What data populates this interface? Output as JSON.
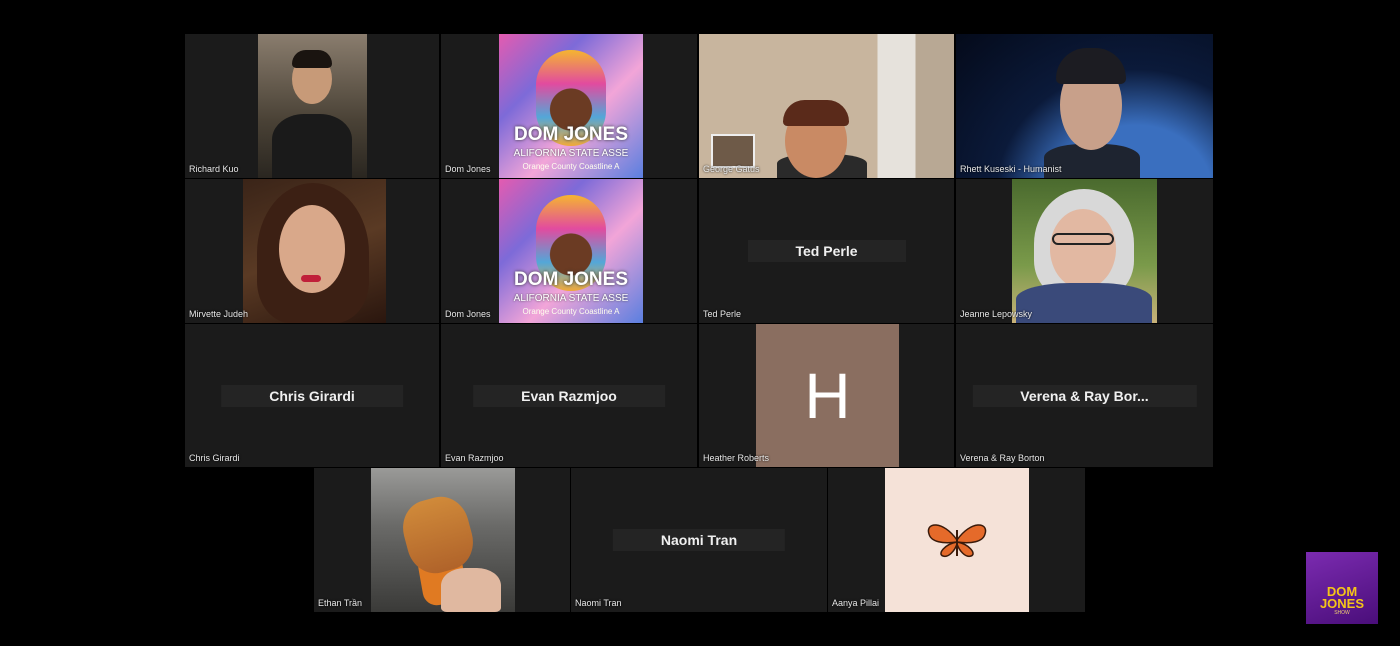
{
  "participants": [
    {
      "name": "Richard Kuo"
    },
    {
      "name": "Dom Jones",
      "poster_title": "DOM JONES",
      "poster_line1": "ALIFORNIA STATE ASSE",
      "poster_line2": "Orange County Coastline A"
    },
    {
      "name": "George Gatus"
    },
    {
      "name": "Rhett Kuseski - Humanist"
    },
    {
      "name": "Mirvette Judeh"
    },
    {
      "name": "Dom Jones",
      "poster_title": "DOM JONES",
      "poster_line1": "ALIFORNIA STATE ASSE",
      "poster_line2": "Orange County Coastline A"
    },
    {
      "name": "Ted Perle",
      "display": "Ted Perle"
    },
    {
      "name": "Jeanne Lepowsky"
    },
    {
      "name": "Chris Girardi",
      "display": "Chris Girardi"
    },
    {
      "name": "Evan Razmjoo",
      "display": "Evan Razmjoo"
    },
    {
      "name": "Heather Roberts",
      "initial": "H"
    },
    {
      "name": "Verena & Ray Borton",
      "display": "Verena & Ray Bor..."
    },
    {
      "name": "Ethan Trần"
    },
    {
      "name": "Naomi Tran",
      "display": "Naomi Tran"
    },
    {
      "name": "Aanya Pillai"
    }
  ],
  "logo": {
    "line1": "DOM",
    "line2": "JONES",
    "line3": "SHOW"
  },
  "colors": {
    "background": "#000000",
    "tile": "#1b1b1b",
    "avatar_h": "#8a6e60",
    "logo_purple": "#6a1fa0",
    "logo_gold": "#f5c518"
  }
}
